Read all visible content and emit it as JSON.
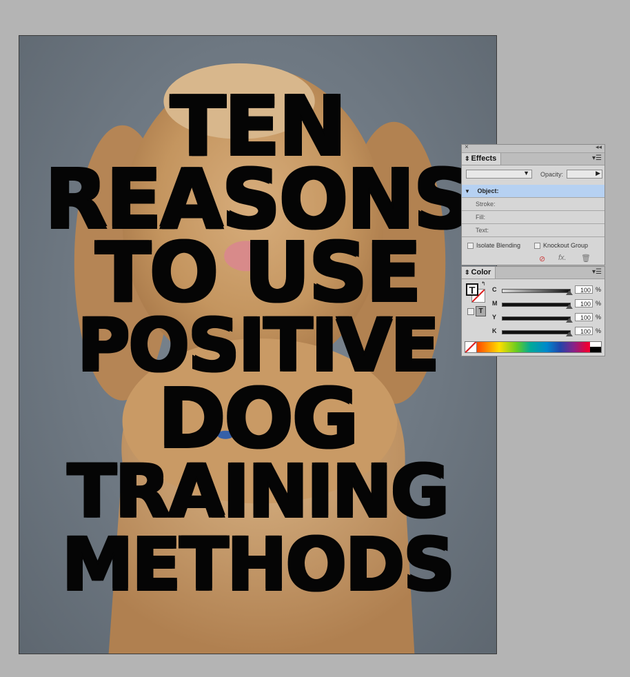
{
  "page": {
    "headline_lines": [
      "TEN",
      "REASONS",
      "TO USE",
      "POSITIVE",
      "DOG",
      "TRAINING",
      "METHODS"
    ]
  },
  "effects_panel": {
    "tab_label": "Effects",
    "opacity_label": "Opacity:",
    "opacity_value": "",
    "blend_mode": "",
    "items": [
      "Object:",
      "Stroke:",
      "Fill:",
      "Text:"
    ],
    "isolate_blending": "Isolate Blending",
    "knockout_group": "Knockout Group",
    "fx_label": "fx."
  },
  "color_panel": {
    "tab_label": "Color",
    "channels": [
      {
        "name": "C",
        "value": "100",
        "unit": "%"
      },
      {
        "name": "M",
        "value": "100",
        "unit": "%"
      },
      {
        "name": "Y",
        "value": "100",
        "unit": "%"
      },
      {
        "name": "K",
        "value": "100",
        "unit": "%"
      }
    ],
    "text_icon": "T"
  },
  "colors": {
    "pasteboard": "#b4b4b4",
    "panel_bg": "#d6d6d6",
    "selection": "#b6d1f2",
    "headline": "#050505"
  }
}
